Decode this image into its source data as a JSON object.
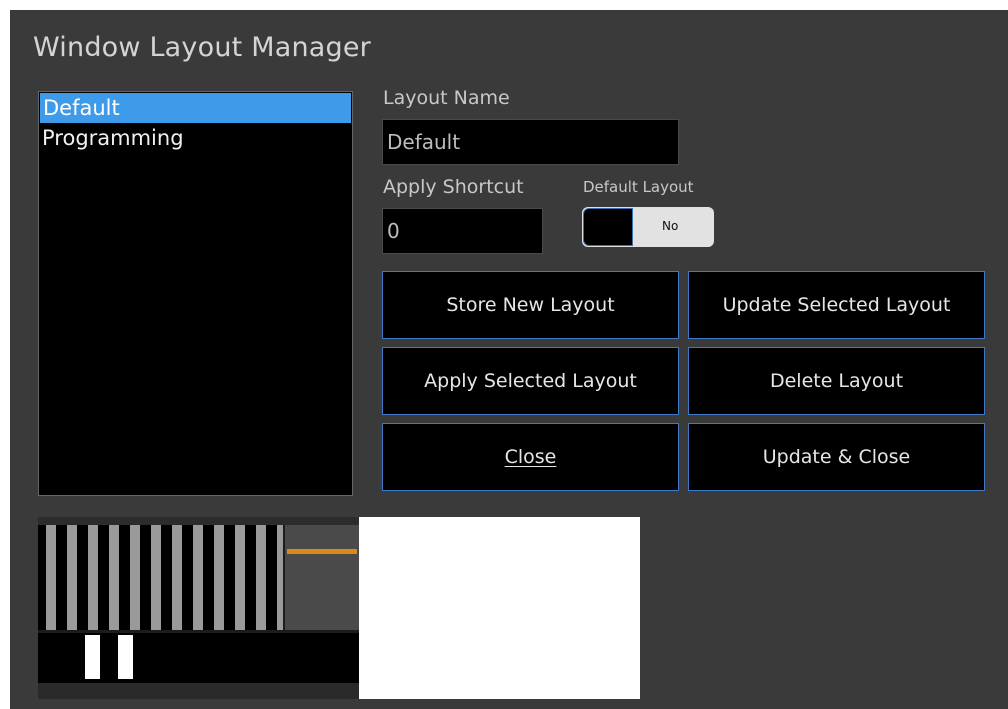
{
  "title": "Window Layout Manager",
  "layouts": [
    "Default",
    "Programming"
  ],
  "selected_layout": "Default",
  "form": {
    "layout_name_label": "Layout Name",
    "layout_name_value": "Default",
    "apply_shortcut_label": "Apply Shortcut",
    "apply_shortcut_value": "0",
    "default_layout_label": "Default Layout",
    "default_layout_state": "No"
  },
  "buttons": {
    "store_new": "Store New Layout",
    "update_selected": "Update Selected Layout",
    "apply_selected": "Apply Selected Layout",
    "delete": "Delete Layout",
    "close": "Close",
    "update_close": "Update & Close"
  },
  "colors": {
    "selection": "#3d9be9",
    "button_border": "#3e78c6",
    "window_bg": "#3a3a3a"
  }
}
